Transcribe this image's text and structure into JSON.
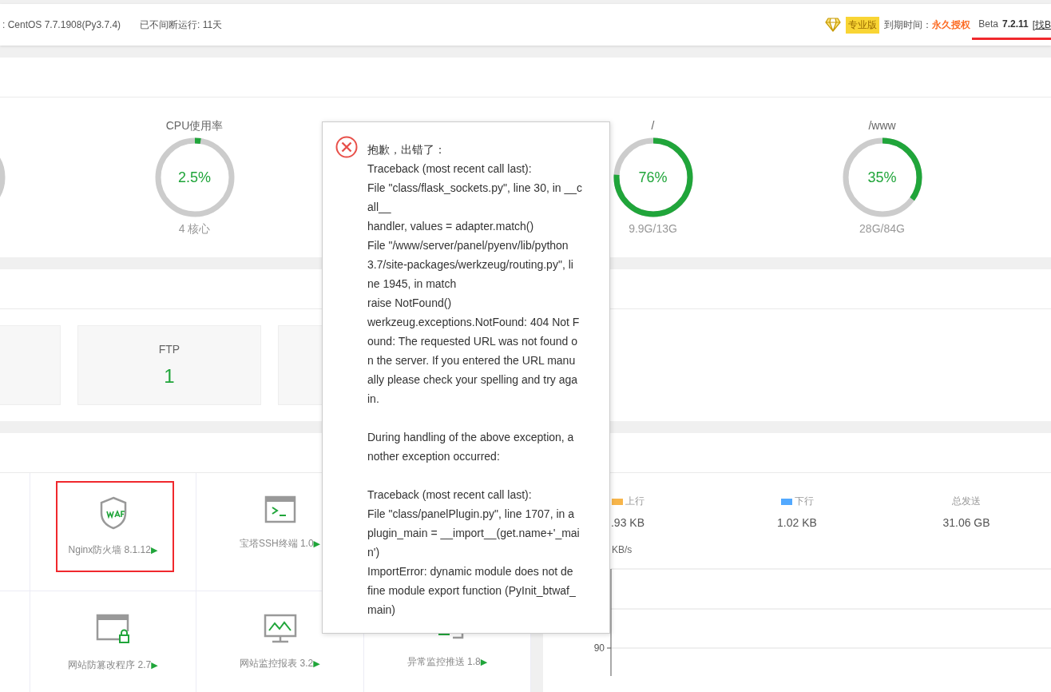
{
  "header": {
    "os": ": CentOS 7.7.1908(Py3.7.4)",
    "uptime": "已不间断运行: 11天",
    "edition": "专业版",
    "expiry_label": "到期时间：",
    "expiry_value": "永久授权",
    "channel": "Beta",
    "version": "7.2.11",
    "version_marked": true,
    "link": "[找B"
  },
  "gauges": [
    {
      "title": "CPU使用率",
      "value": "2.5%",
      "level": 0.025,
      "detail": "4 核心"
    },
    {
      "title": "/",
      "value": "76%",
      "level": 0.76,
      "detail": "9.9G/13G"
    },
    {
      "title": "/www",
      "value": "35%",
      "level": 0.35,
      "detail": "28G/84G"
    }
  ],
  "stat_cards": [
    {
      "label": "FTP",
      "value": "1"
    }
  ],
  "plugins": [
    {
      "name": "Nginx防火墙 8.1.12",
      "arrow": "▶",
      "kind": "waf",
      "highlighted": true
    },
    {
      "name": "宝塔SSH终端 1.0",
      "arrow": "▶",
      "kind": "terminal",
      "highlighted": false
    },
    {
      "name": "网站防篡改程序 2.7",
      "arrow": "▶",
      "kind": "lockwindow",
      "highlighted": false
    },
    {
      "name": "网站监控报表 3.2",
      "arrow": "▶",
      "kind": "monitor",
      "highlighted": false
    },
    {
      "name": "异常监控推送 1.8",
      "arrow": "▶",
      "kind": "push",
      "highlighted": false
    }
  ],
  "network": {
    "legend": [
      {
        "label": "上行",
        "color": "#f7b54a",
        "value": ".93 KB"
      },
      {
        "label": "下行",
        "color": "#52a9ff",
        "value": "1.02 KB"
      },
      {
        "label": "总发送",
        "value": "31.06 GB"
      }
    ],
    "unit": "KB/s",
    "y_tick": "90"
  },
  "error_dialog": {
    "title": "抱歉，出错了：",
    "paragraphs": [
      [
        "Traceback (most recent call last):",
        "File \"class/flask_sockets.py\", line 30, in __c",
        "all__",
        "handler, values = adapter.match()",
        "File \"/www/server/panel/pyenv/lib/python",
        "3.7/site-packages/werkzeug/routing.py\", li",
        "ne 1945, in match",
        "raise NotFound()",
        "werkzeug.exceptions.NotFound: 404 Not F",
        "ound: The requested URL was not found o",
        "n the server. If you entered the URL manu",
        "ally please check your spelling and try aga",
        "in."
      ],
      [
        "During handling of the above exception, a",
        "nother exception occurred:"
      ],
      [
        "Traceback (most recent call last):",
        "File \"class/panelPlugin.py\", line 1707, in a",
        "plugin_main = __import__(get.name+'_mai",
        "n')",
        "ImportError: dynamic module does not de",
        "fine module export function (PyInit_btwaf_",
        "main)"
      ]
    ]
  }
}
